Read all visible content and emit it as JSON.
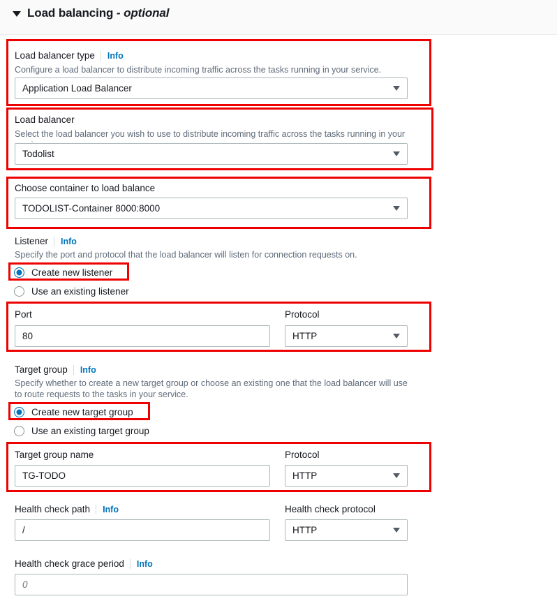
{
  "section": {
    "title": "Load balancing",
    "optional_suffix": "- optional",
    "chevron_icon": "chevron-down-icon",
    "expanded": true
  },
  "info_label": "Info",
  "fields": {
    "load_balancer_type": {
      "label": "Load balancer type",
      "info": "Info",
      "description": "Configure a load balancer to distribute incoming traffic across the tasks running in your service.",
      "value": "Application Load Balancer",
      "control": "select"
    },
    "load_balancer": {
      "label": "Load balancer",
      "description": "Select the load balancer you wish to use to distribute incoming traffic across the tasks running in your service.",
      "value": "Todolist",
      "control": "select"
    },
    "container": {
      "label": "Choose container to load balance",
      "value": "TODOLIST-Container 8000:8000",
      "control": "select"
    },
    "listener": {
      "label": "Listener",
      "info": "Info",
      "description": "Specify the port and protocol that the load balancer will listen for connection requests on.",
      "options": [
        {
          "label": "Create new listener",
          "selected": true
        },
        {
          "label": "Use an existing listener",
          "selected": false
        }
      ]
    },
    "port": {
      "label": "Port",
      "value": "80",
      "control": "text"
    },
    "listener_protocol": {
      "label": "Protocol",
      "value": "HTTP",
      "control": "select"
    },
    "target_group": {
      "label": "Target group",
      "info": "Info",
      "description": "Specify whether to create a new target group or choose an existing one that the load balancer will use\nto route requests to the tasks in your service.",
      "options": [
        {
          "label": "Create new target group",
          "selected": true
        },
        {
          "label": "Use an existing target group",
          "selected": false
        }
      ]
    },
    "target_group_name": {
      "label": "Target group name",
      "value": "TG-TODO",
      "control": "text"
    },
    "target_group_protocol": {
      "label": "Protocol",
      "value": "HTTP",
      "control": "select"
    },
    "health_check_path": {
      "label": "Health check path",
      "info": "Info",
      "value": "/",
      "control": "text"
    },
    "health_check_protocol": {
      "label": "Health check protocol",
      "value": "HTTP",
      "control": "select"
    },
    "health_check_grace_period": {
      "label": "Health check grace period",
      "info": "Info",
      "placeholder": "0",
      "value": "",
      "control": "text"
    }
  },
  "colors": {
    "annotation": "#ee0000",
    "link": "#0073bb",
    "radio_selected": "#0073bb",
    "border": "#aab7b8",
    "header_bg": "#fafafa",
    "text": "#16191f",
    "muted_text": "#5f6b7a"
  },
  "annotations": {
    "highlight_count": 8,
    "note": "red rectangles highlighting configured fields"
  }
}
